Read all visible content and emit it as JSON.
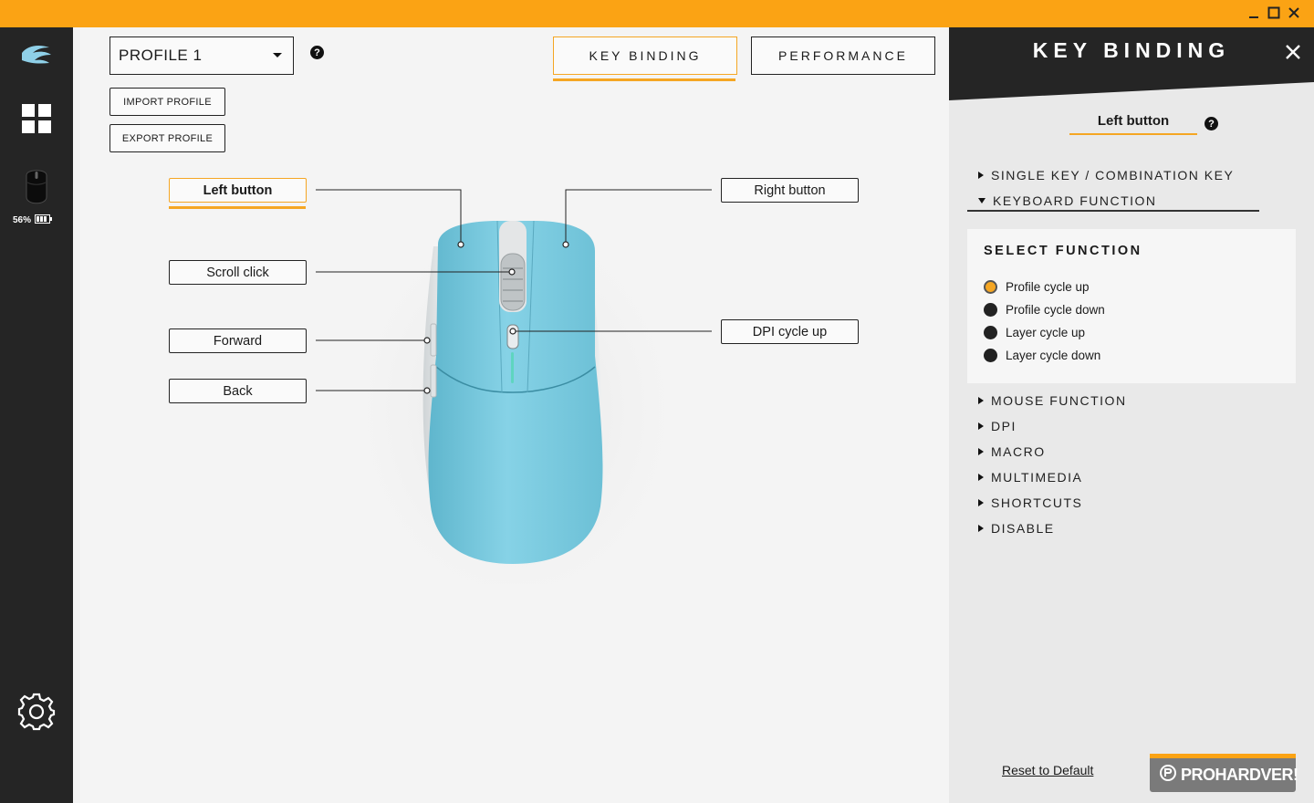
{
  "window": {
    "controls": [
      "minimize-icon",
      "maximize-icon",
      "close-icon"
    ],
    "titlebar_color": "#fba314"
  },
  "sidebar": {
    "battery_percent": "56%",
    "icons": [
      "logo-icon",
      "dashboard-grid-icon",
      "mouse-device-icon",
      "battery-icon",
      "settings-gear-icon"
    ]
  },
  "profile": {
    "selected": "PROFILE 1",
    "help": "?",
    "import_label": "IMPORT PROFILE",
    "export_label": "EXPORT PROFILE"
  },
  "tabs": [
    {
      "label": "KEY BINDING",
      "active": true
    },
    {
      "label": "PERFORMANCE",
      "active": false
    }
  ],
  "mouse_buttons": {
    "left": "Left button",
    "right": "Right button",
    "scroll": "Scroll click",
    "dpi": "DPI cycle up",
    "forward": "Forward",
    "back": "Back",
    "selected": "left"
  },
  "panel": {
    "title": "KEY BINDING",
    "selected_button": "Left button",
    "help": "?",
    "categories_top": [
      {
        "label": "SINGLE KEY / COMBINATION KEY",
        "expanded": false
      },
      {
        "label": "KEYBOARD FUNCTION",
        "expanded": true
      }
    ],
    "select_function": {
      "title": "SELECT FUNCTION",
      "options": [
        "Profile cycle up",
        "Profile cycle down",
        "Layer cycle up",
        "Layer cycle down"
      ],
      "selected_index": 0
    },
    "categories_bottom": [
      "MOUSE FUNCTION",
      "DPI",
      "MACRO",
      "MULTIMEDIA",
      "SHORTCUTS",
      "DISABLE"
    ],
    "reset_label": "Reset to Default"
  },
  "watermark": {
    "text": "PROHARDVER!"
  },
  "colors": {
    "accent": "#f5a623",
    "sidebar_bg": "#252525",
    "panel_bg": "#e9e9e9",
    "mouse_body": "#7ccbe0"
  }
}
